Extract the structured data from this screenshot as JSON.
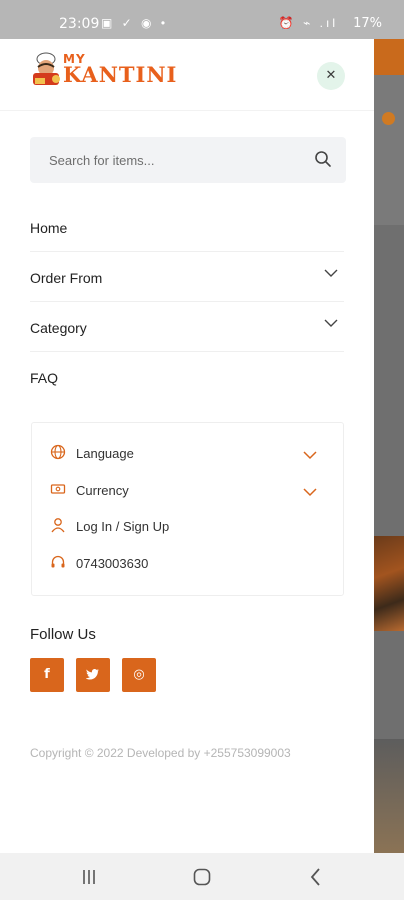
{
  "status_bar": {
    "time": "23:09",
    "left_icons": "▣ ✓ ◉ •",
    "right_icons": "⏰ ⌁ .ıl",
    "battery": "17%"
  },
  "header": {
    "logo_my": "MY",
    "logo_name": "KANTINI",
    "close_symbol": "✕"
  },
  "search": {
    "placeholder": "Search for items..."
  },
  "menu": {
    "items": [
      {
        "label": "Home",
        "icon": null
      },
      {
        "label": "Order From",
        "icon": "chevron-down-icon"
      },
      {
        "label": "Category",
        "icon": "chevron-down-icon"
      },
      {
        "label": "FAQ",
        "icon": null
      }
    ]
  },
  "settings": {
    "language": "Language",
    "currency": "Currency",
    "login": "Log In / Sign Up",
    "phone": "0743003630"
  },
  "follow": {
    "title": "Follow Us",
    "facebook": "f",
    "instagram": "◎"
  },
  "footer": {
    "copyright": "Copyright © 2022 Developed by +255753099003"
  },
  "colors": {
    "accent": "#d9661c",
    "close_bg": "#e3f4ea",
    "search_bg": "#f2f3f5"
  }
}
